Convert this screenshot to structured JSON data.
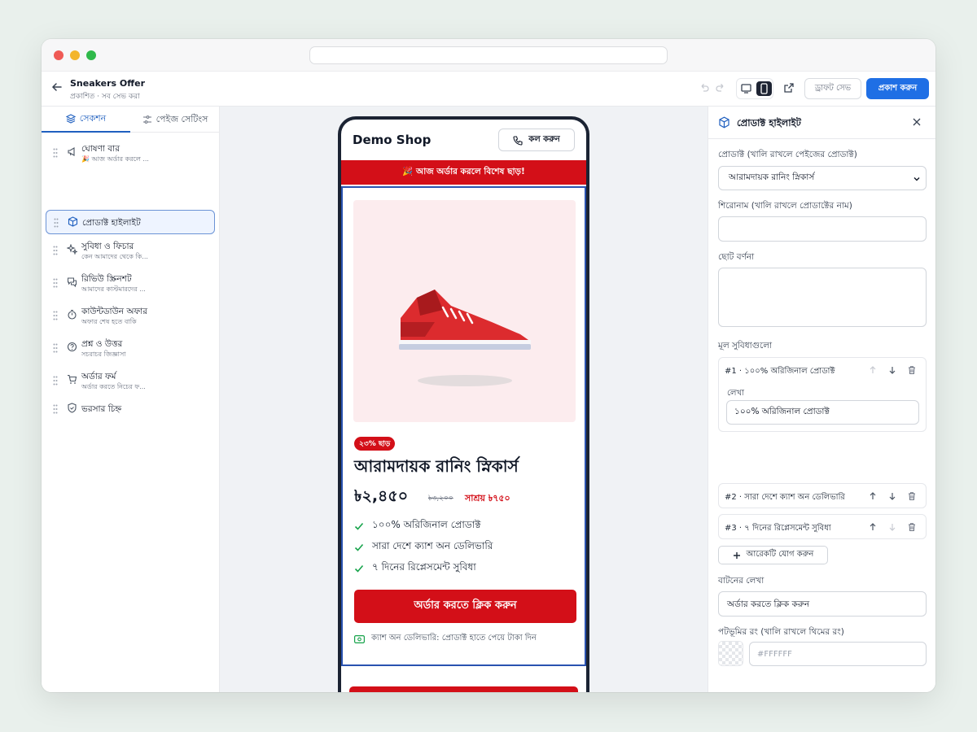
{
  "page_title": "Sneakers Offer",
  "page_status": "প্রকাশিত · সব সেভ করা",
  "toolbar": {
    "draft_label": "ড্রাফট সেভ",
    "publish_label": "প্রকাশ করুন"
  },
  "left_tabs": {
    "sections": "সেকশন",
    "page_settings": "পেইজ সেটিংস"
  },
  "sections": [
    {
      "title": "ঘোষণা বার",
      "subtitle": "🎉 আজ অর্ডার করলে ...",
      "icon": "megaphone-icon"
    },
    {
      "title": "প্রোডাক্ট হাইলাইট",
      "subtitle": "",
      "icon": "box-icon",
      "active": true
    },
    {
      "title": "সুবিধা ও ফিচার",
      "subtitle": "কেন আমাদের থেকে কি...",
      "icon": "sparkle-icon"
    },
    {
      "title": "রিভিউ স্ক্রিনশট",
      "subtitle": "আমাদের কাস্টমারদের ...",
      "icon": "chat-icon"
    },
    {
      "title": "কাউন্টডাউন অফার",
      "subtitle": "অফার শেষ হতে বাকি",
      "icon": "timer-icon"
    },
    {
      "title": "প্রশ্ন ও উত্তর",
      "subtitle": "সচরাচর জিজ্ঞাসা",
      "icon": "question-icon"
    },
    {
      "title": "অর্ডার ফর্ম",
      "subtitle": "অর্ডার করতে নিচের ফ...",
      "icon": "cart-icon"
    },
    {
      "title": "ভরসার চিহ্ন",
      "subtitle": "",
      "icon": "shield-icon"
    }
  ],
  "preview": {
    "shop_name": "Demo Shop",
    "call_label": "কল করুন",
    "announcement": "🎉 আজ অর্ডার করলে বিশেষ ছাড়!",
    "discount_badge": "২৩% ছাড়",
    "product_name": "আরামদায়ক রানিং স্নিকার্স",
    "price": "৳২,৪৫০",
    "old_price": "৳৩,২০০",
    "save_text": "সাশ্রয় ৳৭৫০",
    "features": [
      "১০০% অরিজিনাল প্রোডাক্ট",
      "সারা দেশে ক্যাশ অন ডেলিভারি",
      "৭ দিনের রিপ্লেসমেন্ট সুবিধা"
    ],
    "order_button": "অর্ডার করতে ক্লিক করুন",
    "cod_note": "ক্যাশ অন ডেলিভারি: প্রোডাক্ট হাতে পেয়ে টাকা দিন"
  },
  "panel": {
    "title": "প্রোডাক্ট হাইলাইট",
    "product_label": "প্রোডাক্ট (খালি রাখলে পেইজের প্রোডাক্ট)",
    "product_value": "আরামদায়ক রানিং স্নিকার্স",
    "heading_label": "শিরোনাম (খালি রাখলে প্রোডাক্টের নাম)",
    "heading_value": "",
    "desc_label": "ছোট বর্ণনা",
    "desc_value": "",
    "features_label": "মূল সুবিধাগুলো",
    "feature_items": [
      {
        "head": "#1 · ১০০% অরিজিনাল প্রোডাক্ট",
        "text_label": "লেখা",
        "text": "১০০% অরিজিনাল প্রোডাক্ট"
      },
      {
        "head": "#2 · সারা দেশে ক্যাশ অন ডেলিভারি"
      },
      {
        "head": "#3 · ৭ দিনের রিপ্লেসমেন্ট সুবিধা"
      }
    ],
    "add_label": "আরেকটি যোগ করুন",
    "button_text_label": "বাটনের লেখা",
    "button_text_value": "অর্ডার করতে ক্লিক করুন",
    "bg_label": "পটভূমির রং (খালি রাখলে থিমের রং)",
    "bg_placeholder": "#FFFFFF"
  },
  "colors": {
    "accent": "#1f6fe5",
    "brand_red": "#d30f18",
    "dark": "#1b2333"
  }
}
